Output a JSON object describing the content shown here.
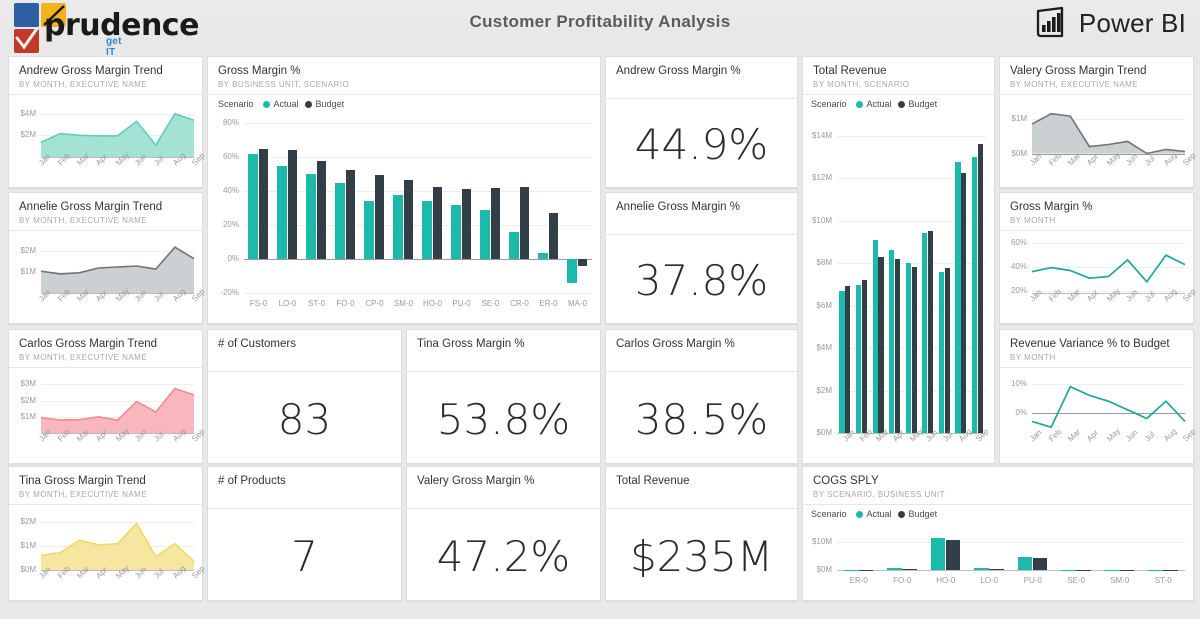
{
  "header": {
    "brand": "prudence",
    "tagline": "get IT right",
    "title": "Customer Profitability Analysis",
    "powerbi_label": "Power BI",
    "logo_icon": "prudence-squares-logo",
    "powerbi_icon": "power-bi-bars-icon"
  },
  "colors": {
    "teal": "#1cbaab",
    "dark": "#333f48",
    "gray_area_fill": "#c8cdd0",
    "gray_area_line": "#6f7478",
    "mint_fill": "#9fe0d2",
    "mint_line": "#5fcdbb",
    "pink_fill": "#f7b3b8",
    "pink_line": "#ef8b93",
    "yellow_fill": "#f7e59a",
    "yellow_line": "#eed96b",
    "line_teal": "#18a999"
  },
  "tiles": {
    "andrew_trend": {
      "title": "Andrew Gross Margin Trend",
      "subtitle": "BY MONTH, EXECUTIVE NAME"
    },
    "annelie_trend": {
      "title": "Annelie Gross Margin Trend",
      "subtitle": "BY MONTH, EXECUTIVE NAME"
    },
    "carlos_trend": {
      "title": "Carlos Gross Margin Trend",
      "subtitle": "BY MONTH, EXECUTIVE NAME"
    },
    "tina_trend": {
      "title": "Tina Gross Margin Trend",
      "subtitle": "BY MONTH, EXECUTIVE NAME"
    },
    "valery_trend": {
      "title": "Valery Gross Margin Trend",
      "subtitle": "BY MONTH, EXECUTIVE NAME"
    },
    "gm_bu": {
      "title": "Gross Margin %",
      "subtitle": "BY BUSINESS UNIT, SCENARIO"
    },
    "total_revenue_chart": {
      "title": "Total Revenue",
      "subtitle": "BY MONTH, SCENARIO"
    },
    "gm_month": {
      "title": "Gross Margin %",
      "subtitle": "BY MONTH"
    },
    "rev_var": {
      "title": "Revenue Variance % to Budget",
      "subtitle": "BY MONTH"
    },
    "cogs": {
      "title": "COGS SPLY",
      "subtitle": "BY SCENARIO, BUSINESS UNIT"
    }
  },
  "kpis": {
    "andrew_gm": {
      "title": "Andrew Gross Margin %",
      "value": "44.9%"
    },
    "annelie_gm": {
      "title": "Annelie Gross Margin %",
      "value": "37.8%"
    },
    "customers": {
      "title": "# of Customers",
      "value": "83"
    },
    "tina_gm": {
      "title": "Tina Gross Margin %",
      "value": "53.8%"
    },
    "carlos_gm": {
      "title": "Carlos Gross Margin %",
      "value": "38.5%"
    },
    "products": {
      "title": "# of Products",
      "value": "7"
    },
    "valery_gm": {
      "title": "Valery Gross Margin %",
      "value": "47.2%"
    },
    "total_rev": {
      "title": "Total Revenue",
      "value": "$235M"
    }
  },
  "legend": {
    "scenario_label": "Scenario",
    "actual": "Actual",
    "budget": "Budget"
  },
  "chart_data": [
    {
      "id": "andrew_trend",
      "type": "area",
      "title": "Andrew Gross Margin Trend",
      "subtitle": "BY MONTH, EXECUTIVE NAME",
      "xlabel": "",
      "ylabel": "",
      "x": [
        "Jan",
        "Feb",
        "Mar",
        "Apr",
        "May",
        "Jun",
        "Jul",
        "Aug",
        "Sep"
      ],
      "values": [
        1.35,
        2.15,
        2.0,
        1.95,
        1.95,
        3.3,
        1.1,
        4.0,
        3.4
      ],
      "ytick_labels": [
        "$4M",
        "$2M"
      ],
      "ytick_values": [
        4,
        2
      ],
      "ylim": [
        0,
        4.8
      ],
      "grid": true
    },
    {
      "id": "annelie_trend",
      "type": "area",
      "title": "Annelie Gross Margin Trend",
      "subtitle": "BY MONTH, EXECUTIVE NAME",
      "x": [
        "Jan",
        "Feb",
        "Mar",
        "Apr",
        "May",
        "Jun",
        "Jul",
        "Aug",
        "Sep"
      ],
      "values": [
        1.05,
        0.92,
        0.97,
        1.2,
        1.25,
        1.3,
        1.15,
        2.2,
        1.65
      ],
      "ytick_labels": [
        "$2M",
        "$1M"
      ],
      "ytick_values": [
        2,
        1
      ],
      "ylim": [
        0,
        2.5
      ],
      "grid": true
    },
    {
      "id": "carlos_trend",
      "type": "area",
      "title": "Carlos Gross Margin Trend",
      "subtitle": "BY MONTH, EXECUTIVE NAME",
      "x": [
        "Jan",
        "Feb",
        "Mar",
        "Apr",
        "May",
        "Jun",
        "Jul",
        "Aug",
        "Sep"
      ],
      "values": [
        0.95,
        0.8,
        0.82,
        1.0,
        0.8,
        1.95,
        1.3,
        2.75,
        2.35
      ],
      "ytick_labels": [
        "$3M",
        "$2M",
        "$1M"
      ],
      "ytick_values": [
        3,
        2,
        1
      ],
      "ylim": [
        0,
        3.4
      ],
      "grid": true
    },
    {
      "id": "tina_trend",
      "type": "area",
      "title": "Tina Gross Margin Trend",
      "subtitle": "BY MONTH, EXECUTIVE NAME",
      "x": [
        "Jan",
        "Feb",
        "Mar",
        "Apr",
        "May",
        "Jun",
        "Jul",
        "Aug",
        "Sep"
      ],
      "values": [
        0.62,
        0.72,
        1.25,
        1.05,
        1.1,
        1.95,
        0.55,
        1.1,
        0.35
      ],
      "ytick_labels": [
        "$2M",
        "$1M",
        "$0M"
      ],
      "ytick_values": [
        2,
        1,
        0
      ],
      "ylim": [
        0,
        2.3
      ],
      "grid": true
    },
    {
      "id": "valery_trend",
      "type": "area",
      "title": "Valery Gross Margin Trend",
      "subtitle": "BY MONTH, EXECUTIVE NAME",
      "x": [
        "Jan",
        "Feb",
        "Mar",
        "Apr",
        "May",
        "Jun",
        "Jul",
        "Aug",
        "Sep"
      ],
      "values": [
        0.85,
        1.15,
        1.08,
        0.2,
        0.26,
        0.35,
        0.0,
        0.12,
        0.06
      ],
      "ytick_labels": [
        "$1M",
        "$0M"
      ],
      "ytick_values": [
        1,
        0
      ],
      "ylim": [
        -0.1,
        1.4
      ],
      "grid": true
    },
    {
      "id": "gm_bu",
      "type": "bar",
      "title": "Gross Margin %",
      "subtitle": "BY BUSINESS UNIT, SCENARIO",
      "legend_title": "Scenario",
      "legend_position": "top-left",
      "categories": [
        "FS-0",
        "LO-0",
        "ST-0",
        "FO-0",
        "CP-0",
        "SM-0",
        "HO-0",
        "PU-0",
        "SE-0",
        "CR-0",
        "ER-0",
        "MA-0"
      ],
      "series": [
        {
          "name": "Actual",
          "color": "#1cbaab",
          "values": [
            62,
            55,
            50,
            44.5,
            34,
            37.5,
            34,
            32,
            29,
            16,
            3.5,
            -14
          ]
        },
        {
          "name": "Budget",
          "color": "#333f48",
          "values": [
            65,
            64,
            57.5,
            52.5,
            49.5,
            46.5,
            42.5,
            41,
            42,
            42.5,
            27,
            -4
          ]
        }
      ],
      "ytick_labels": [
        "80%",
        "60%",
        "40%",
        "20%",
        "0%",
        "-20%"
      ],
      "ytick_values": [
        80,
        60,
        40,
        20,
        0,
        -20
      ],
      "ylim": [
        -20,
        80
      ],
      "grid": true,
      "ylabel": "",
      "xlabel": ""
    },
    {
      "id": "total_revenue_chart",
      "type": "bar",
      "title": "Total Revenue",
      "subtitle": "BY MONTH, SCENARIO",
      "legend_title": "Scenario",
      "legend_position": "top-left",
      "categories": [
        "Jan",
        "Feb",
        "Mar",
        "Apr",
        "May",
        "Jun",
        "Jul",
        "Aug",
        "Sep"
      ],
      "series": [
        {
          "name": "Actual",
          "color": "#1cbaab",
          "values": [
            6.7,
            6.95,
            9.1,
            8.6,
            8.0,
            9.4,
            7.6,
            12.75,
            13.0
          ]
        },
        {
          "name": "Budget",
          "color": "#333f48",
          "values": [
            6.9,
            7.2,
            8.3,
            8.2,
            7.8,
            9.5,
            7.75,
            12.25,
            13.6
          ]
        }
      ],
      "ytick_labels": [
        "$14M",
        "$12M",
        "$10M",
        "$8M",
        "$6M",
        "$4M",
        "$2M",
        "$0M"
      ],
      "ytick_values": [
        14,
        12,
        10,
        8,
        6,
        4,
        2,
        0
      ],
      "ylim": [
        0,
        14.6
      ],
      "grid": true
    },
    {
      "id": "gm_month",
      "type": "line",
      "title": "Gross Margin %",
      "subtitle": "BY MONTH",
      "x": [
        "Jan",
        "Feb",
        "Mar",
        "Apr",
        "May",
        "Jun",
        "Jul",
        "Aug",
        "Sep"
      ],
      "values": [
        36,
        39.5,
        37,
        30.5,
        32,
        46,
        27.5,
        50,
        42
      ],
      "ytick_labels": [
        "60%",
        "40%",
        "20%"
      ],
      "ytick_values": [
        60,
        40,
        20
      ],
      "ylim": [
        18,
        62
      ],
      "grid": true,
      "color": "#18a999"
    },
    {
      "id": "rev_var",
      "type": "line",
      "title": "Revenue Variance % to Budget",
      "subtitle": "BY MONTH",
      "x": [
        "Jan",
        "Feb",
        "Mar",
        "Apr",
        "May",
        "Jun",
        "Jul",
        "Aug",
        "Sep"
      ],
      "values": [
        -3,
        -5,
        9,
        6,
        4,
        1,
        -2,
        4,
        -3
      ],
      "ytick_labels": [
        "10%",
        "0%"
      ],
      "ytick_values": [
        10,
        0
      ],
      "ylim": [
        -7,
        12
      ],
      "grid": true,
      "color": "#18a999"
    },
    {
      "id": "cogs",
      "type": "bar",
      "title": "COGS SPLY",
      "subtitle": "BY SCENARIO, BUSINESS UNIT",
      "legend_title": "Scenario",
      "legend_position": "top-left",
      "categories": [
        "ER-0",
        "FO-0",
        "HO-0",
        "LO-0",
        "PU-0",
        "SE-0",
        "SM-0",
        "ST-0"
      ],
      "series": [
        {
          "name": "Actual",
          "color": "#1cbaab",
          "values": [
            0.05,
            0.55,
            11.2,
            0.75,
            4.6,
            0.12,
            0.1,
            0.12
          ]
        },
        {
          "name": "Budget",
          "color": "#333f48",
          "values": [
            0.05,
            0.4,
            10.4,
            0.45,
            4.3,
            0.08,
            0.08,
            0.1
          ]
        }
      ],
      "ytick_labels": [
        "$10M",
        "$0M"
      ],
      "ytick_values": [
        10,
        0
      ],
      "ylim": [
        0,
        13
      ],
      "grid": true
    }
  ]
}
